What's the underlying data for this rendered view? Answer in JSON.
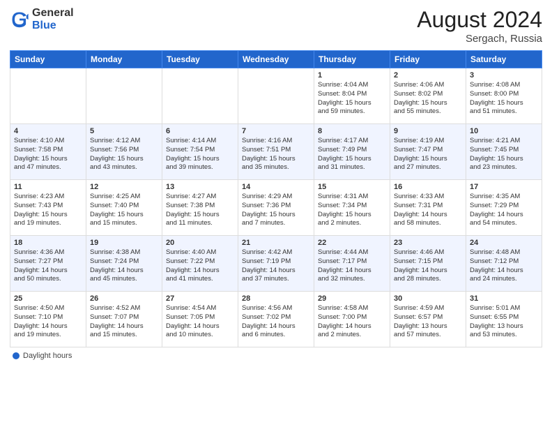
{
  "header": {
    "logo_general": "General",
    "logo_blue": "Blue",
    "month_year": "August 2024",
    "location": "Sergach, Russia"
  },
  "calendar": {
    "days_of_week": [
      "Sunday",
      "Monday",
      "Tuesday",
      "Wednesday",
      "Thursday",
      "Friday",
      "Saturday"
    ],
    "weeks": [
      [
        {
          "day": "",
          "info": ""
        },
        {
          "day": "",
          "info": ""
        },
        {
          "day": "",
          "info": ""
        },
        {
          "day": "",
          "info": ""
        },
        {
          "day": "1",
          "info": "Sunrise: 4:04 AM\nSunset: 8:04 PM\nDaylight: 15 hours\nand 59 minutes."
        },
        {
          "day": "2",
          "info": "Sunrise: 4:06 AM\nSunset: 8:02 PM\nDaylight: 15 hours\nand 55 minutes."
        },
        {
          "day": "3",
          "info": "Sunrise: 4:08 AM\nSunset: 8:00 PM\nDaylight: 15 hours\nand 51 minutes."
        }
      ],
      [
        {
          "day": "4",
          "info": "Sunrise: 4:10 AM\nSunset: 7:58 PM\nDaylight: 15 hours\nand 47 minutes."
        },
        {
          "day": "5",
          "info": "Sunrise: 4:12 AM\nSunset: 7:56 PM\nDaylight: 15 hours\nand 43 minutes."
        },
        {
          "day": "6",
          "info": "Sunrise: 4:14 AM\nSunset: 7:54 PM\nDaylight: 15 hours\nand 39 minutes."
        },
        {
          "day": "7",
          "info": "Sunrise: 4:16 AM\nSunset: 7:51 PM\nDaylight: 15 hours\nand 35 minutes."
        },
        {
          "day": "8",
          "info": "Sunrise: 4:17 AM\nSunset: 7:49 PM\nDaylight: 15 hours\nand 31 minutes."
        },
        {
          "day": "9",
          "info": "Sunrise: 4:19 AM\nSunset: 7:47 PM\nDaylight: 15 hours\nand 27 minutes."
        },
        {
          "day": "10",
          "info": "Sunrise: 4:21 AM\nSunset: 7:45 PM\nDaylight: 15 hours\nand 23 minutes."
        }
      ],
      [
        {
          "day": "11",
          "info": "Sunrise: 4:23 AM\nSunset: 7:43 PM\nDaylight: 15 hours\nand 19 minutes."
        },
        {
          "day": "12",
          "info": "Sunrise: 4:25 AM\nSunset: 7:40 PM\nDaylight: 15 hours\nand 15 minutes."
        },
        {
          "day": "13",
          "info": "Sunrise: 4:27 AM\nSunset: 7:38 PM\nDaylight: 15 hours\nand 11 minutes."
        },
        {
          "day": "14",
          "info": "Sunrise: 4:29 AM\nSunset: 7:36 PM\nDaylight: 15 hours\nand 7 minutes."
        },
        {
          "day": "15",
          "info": "Sunrise: 4:31 AM\nSunset: 7:34 PM\nDaylight: 15 hours\nand 2 minutes."
        },
        {
          "day": "16",
          "info": "Sunrise: 4:33 AM\nSunset: 7:31 PM\nDaylight: 14 hours\nand 58 minutes."
        },
        {
          "day": "17",
          "info": "Sunrise: 4:35 AM\nSunset: 7:29 PM\nDaylight: 14 hours\nand 54 minutes."
        }
      ],
      [
        {
          "day": "18",
          "info": "Sunrise: 4:36 AM\nSunset: 7:27 PM\nDaylight: 14 hours\nand 50 minutes."
        },
        {
          "day": "19",
          "info": "Sunrise: 4:38 AM\nSunset: 7:24 PM\nDaylight: 14 hours\nand 45 minutes."
        },
        {
          "day": "20",
          "info": "Sunrise: 4:40 AM\nSunset: 7:22 PM\nDaylight: 14 hours\nand 41 minutes."
        },
        {
          "day": "21",
          "info": "Sunrise: 4:42 AM\nSunset: 7:19 PM\nDaylight: 14 hours\nand 37 minutes."
        },
        {
          "day": "22",
          "info": "Sunrise: 4:44 AM\nSunset: 7:17 PM\nDaylight: 14 hours\nand 32 minutes."
        },
        {
          "day": "23",
          "info": "Sunrise: 4:46 AM\nSunset: 7:15 PM\nDaylight: 14 hours\nand 28 minutes."
        },
        {
          "day": "24",
          "info": "Sunrise: 4:48 AM\nSunset: 7:12 PM\nDaylight: 14 hours\nand 24 minutes."
        }
      ],
      [
        {
          "day": "25",
          "info": "Sunrise: 4:50 AM\nSunset: 7:10 PM\nDaylight: 14 hours\nand 19 minutes."
        },
        {
          "day": "26",
          "info": "Sunrise: 4:52 AM\nSunset: 7:07 PM\nDaylight: 14 hours\nand 15 minutes."
        },
        {
          "day": "27",
          "info": "Sunrise: 4:54 AM\nSunset: 7:05 PM\nDaylight: 14 hours\nand 10 minutes."
        },
        {
          "day": "28",
          "info": "Sunrise: 4:56 AM\nSunset: 7:02 PM\nDaylight: 14 hours\nand 6 minutes."
        },
        {
          "day": "29",
          "info": "Sunrise: 4:58 AM\nSunset: 7:00 PM\nDaylight: 14 hours\nand 2 minutes."
        },
        {
          "day": "30",
          "info": "Sunrise: 4:59 AM\nSunset: 6:57 PM\nDaylight: 13 hours\nand 57 minutes."
        },
        {
          "day": "31",
          "info": "Sunrise: 5:01 AM\nSunset: 6:55 PM\nDaylight: 13 hours\nand 53 minutes."
        }
      ]
    ]
  },
  "legend": {
    "daylight_hours": "Daylight hours"
  }
}
